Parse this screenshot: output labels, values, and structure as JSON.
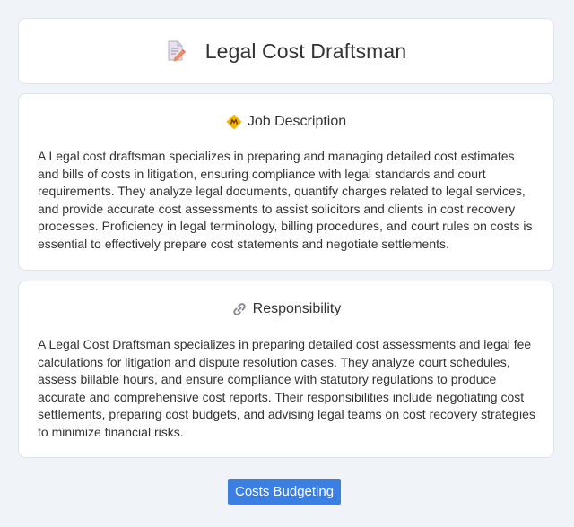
{
  "header": {
    "title": "Legal Cost Draftsman",
    "icon": "document-pencil-icon"
  },
  "job_description": {
    "heading": "Job Description",
    "icon": "diamond-badge-icon",
    "text": "A Legal cost draftsman specializes in preparing and managing detailed cost estimates and bills of costs in litigation, ensuring compliance with legal standards and court requirements. They analyze legal documents, quantify charges related to legal services, and provide accurate cost assessments to assist solicitors and clients in cost recovery processes. Proficiency in legal terminology, billing procedures, and court rules on costs is essential to effectively prepare cost statements and negotiate settlements."
  },
  "responsibility": {
    "heading": "Responsibility",
    "icon": "link-icon",
    "text": "A Legal Cost Draftsman specializes in preparing detailed cost assessments and legal fee calculations for litigation and dispute resolution cases. They analyze court schedules, assess billable hours, and ensure compliance with statutory regulations to produce accurate and comprehensive cost reports. Their responsibilities include negotiating cost settlements, preparing cost budgets, and advising legal teams on cost recovery strategies to minimize financial risks."
  },
  "tag": {
    "label": "Costs Budgeting"
  },
  "colors": {
    "background": "#f0f3f8",
    "card": "#ffffff",
    "accent": "#3c7fe3",
    "text": "#333333"
  }
}
